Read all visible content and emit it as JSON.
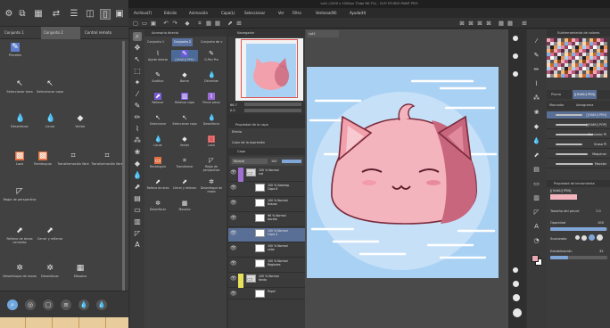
{
  "window": {
    "title": "Lot1 (1000 x 1000px 72dpi 66.7%) - CLIP STUDIO PAINT PRO"
  },
  "menu": [
    "Archivo(F)",
    "Edición",
    "Animación",
    "Capa(L)",
    "Seleccionar",
    "Ver",
    "Filtro",
    "Ventana(W)",
    "Ayuda(H)"
  ],
  "left_panel": {
    "tabs": [
      "Conjunto 1",
      "Conjunto 2",
      "Control remoto"
    ],
    "items": [
      {
        "label": "Pinceles"
      },
      {
        "label": "Seleccionar área"
      },
      {
        "label": "Seleccionar capa"
      },
      {
        "label": "Desenfocar"
      },
      {
        "label": "Licuar"
      },
      {
        "label": "Vector"
      },
      {
        "label": "Lazo"
      },
      {
        "label": "Rectángulo"
      },
      {
        "label": "Transformación libre"
      },
      {
        "label": "Transformación libre"
      },
      {
        "label": "Regla de perspectiva"
      },
      {
        "label": "Relleno de áreas cerradas"
      },
      {
        "label": "Cerrar y rellenar"
      },
      {
        "label": "Desenfoque de modo"
      },
      {
        "label": "Desenfocar"
      },
      {
        "label": "Mosaico"
      }
    ]
  },
  "subtool": {
    "title": "Accesorio directo",
    "tabs": [
      "Conjunto 1",
      "Conjunto 2",
      "Conjunto de v"
    ],
    "items": [
      {
        "label": "Ajuste directo"
      },
      {
        "label": "[[HAKU] PEN]"
      },
      {
        "label": "G-Pen Pro"
      },
      {
        "label": "Sustituir"
      },
      {
        "label": "Borrar"
      },
      {
        "label": "Difuminar"
      },
      {
        "label": "Rellenar"
      },
      {
        "label": "Rellenar capa"
      },
      {
        "label": "Pincel plano"
      },
      {
        "label": "Seleccionar"
      },
      {
        "label": "Seleccionar capa"
      },
      {
        "label": "Desenfocar"
      },
      {
        "label": "Licuar"
      },
      {
        "label": "Vector"
      },
      {
        "label": "Lazo"
      },
      {
        "label": "Rectángulo"
      },
      {
        "label": "Transformar"
      },
      {
        "label": "Regla de perspectiva"
      },
      {
        "label": "Relleno de área"
      },
      {
        "label": "Cerrar y rellenar"
      },
      {
        "label": "Desenfoque de modo"
      },
      {
        "label": "Desenfocar"
      },
      {
        "label": "Mosaico"
      }
    ]
  },
  "navigator": {
    "title": "Navegador",
    "zoom": "66.7",
    "angle": "0.0"
  },
  "property": {
    "title": "Propiedad de la capa",
    "effect_label": "Efecto",
    "color_label": "Color de la expresión"
  },
  "layers": {
    "title": "Capa",
    "blend_mode": "Normal",
    "opacity": "100",
    "rows": [
      {
        "name": "100 % Normal\ncat",
        "folder": true,
        "selected": false,
        "clip": "#a070d0"
      },
      {
        "name": "100 % Sobrexp.\nCapa 8",
        "folder": false,
        "selected": false,
        "clip": ""
      },
      {
        "name": "100 % Normal\nbrazos",
        "folder": false,
        "selected": false,
        "clip": ""
      },
      {
        "name": "96 % Normal\nboceto",
        "folder": false,
        "selected": false,
        "clip": ""
      },
      {
        "name": "100 % Normal\nCapa 4",
        "folder": false,
        "selected": true,
        "clip": ""
      },
      {
        "name": "100 % Normal\ncolor",
        "folder": false,
        "selected": false,
        "clip": ""
      },
      {
        "name": "100 % Normal\nRegiones",
        "folder": false,
        "selected": false,
        "clip": ""
      },
      {
        "name": "100 % Normal\nfondo",
        "folder": true,
        "selected": false,
        "clip": "#e6e05a"
      },
      {
        "name": "Papel",
        "folder": false,
        "selected": false,
        "clip": ""
      }
    ]
  },
  "canvas_tab": "Lot1",
  "color_set": {
    "title": "Subherramienta de colores"
  },
  "brush_panel": {
    "tabs": [
      "Pluma",
      "[[HAKU] PEN]",
      "Marcador",
      "Aerograma"
    ],
    "brushes": [
      "[[HAKU] PEN]",
      "[[HAKU] POP]",
      "Rotulador PI",
      "Grasa PI",
      "Maquinar",
      "Mezclar"
    ]
  },
  "tool_property": {
    "title": "Propiedad de herramienta",
    "brush": "[[HAKU] PEN]",
    "size_label": "Tamaño del pincel",
    "size_value": "7.0",
    "opacity_label": "Opacidad",
    "opacity_value": "100",
    "opacity_fraction": 0.98,
    "smoothing_label": "Suavizado",
    "stabilization_label": "Estabilización",
    "stabilization_value": "32",
    "stabilization_fraction": 0.32
  },
  "colors": {
    "accent": "#5a6f96",
    "canvas_bg": "#a9d1f4",
    "cat_pink": "#f2a0ab",
    "cat_dark": "#c86a7f",
    "fg": "#e8a9b3",
    "bg": "#ffffff"
  }
}
